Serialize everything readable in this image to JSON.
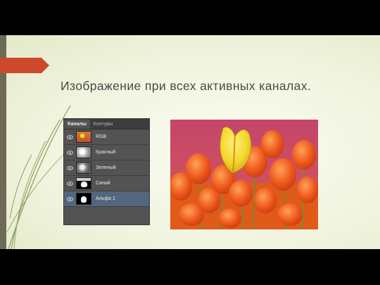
{
  "slide": {
    "title": "Изображение при всех активных каналах."
  },
  "channels_panel": {
    "tabs": [
      {
        "label": "Каналы"
      },
      {
        "label": "Контуры"
      }
    ],
    "rows": [
      {
        "label": "RGB",
        "thumb": "rgb"
      },
      {
        "label": "Красный",
        "thumb": "red"
      },
      {
        "label": "Зеленый",
        "thumb": "green"
      },
      {
        "label": "Синий",
        "thumb": "blue"
      },
      {
        "label": "Альфа 1",
        "thumb": "alpha",
        "selected": true
      }
    ],
    "icons": {
      "visibility": "eye-icon"
    }
  },
  "colors": {
    "accent_red": "#cc4a2b",
    "panel_bg": "#535353",
    "selected_row": "#52677f",
    "tulip_yellow": "#f3d82a",
    "tulip_orange": "#ee5a1c",
    "sky_pink": "#c4456a"
  }
}
